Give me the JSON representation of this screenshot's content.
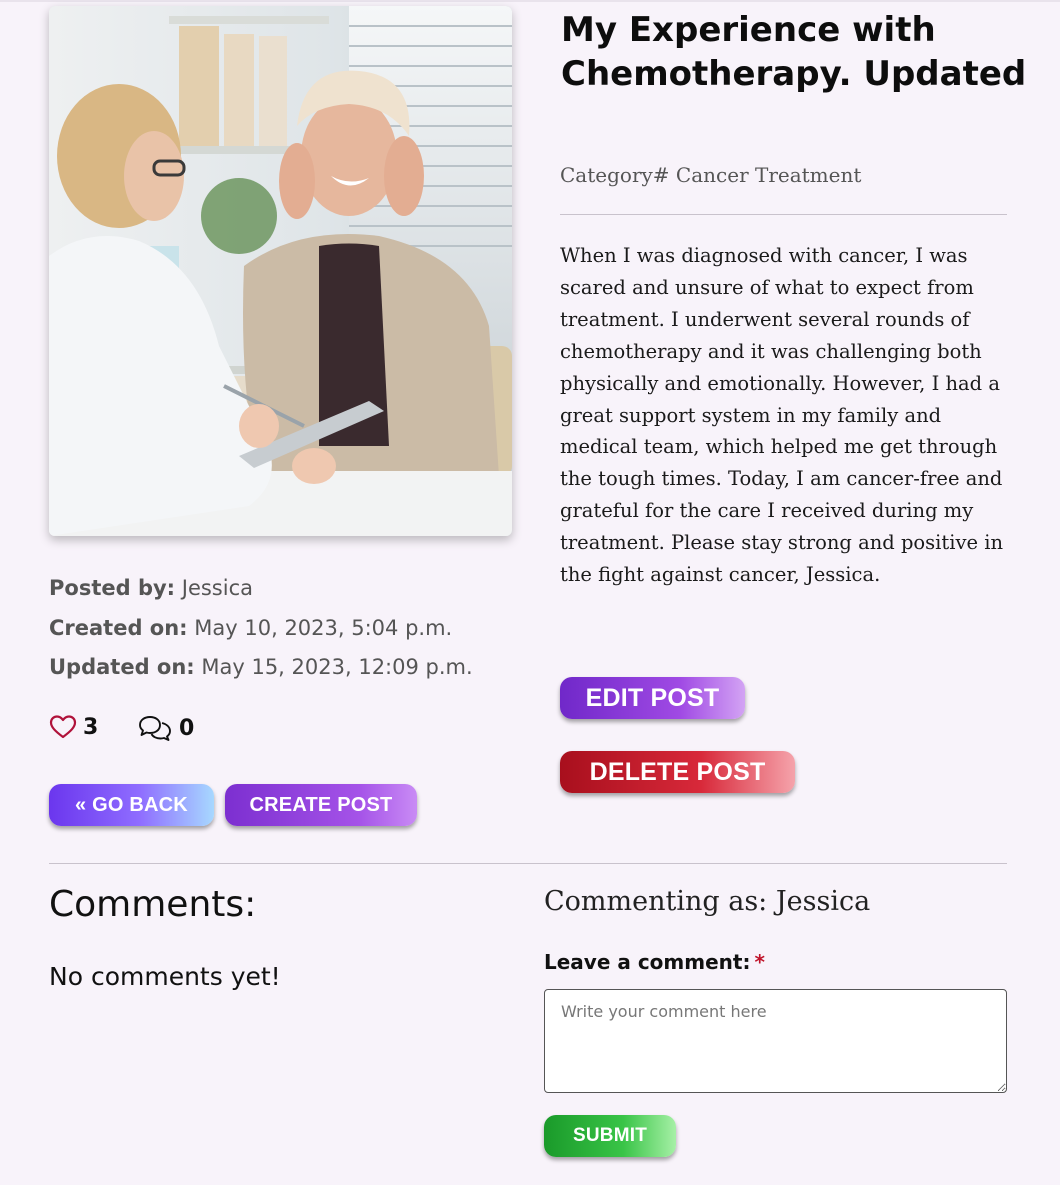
{
  "post": {
    "title": "My Experience with Chemotherapy. Updated",
    "category": "Category# Cancer Treatment",
    "body": "When I was diagnosed with cancer, I was scared and unsure of what to expect from treatment. I underwent several rounds of chemotherapy and it was challenging both physically and emotionally. However, I had a great support system in my family and medical team, which helped me get through the tough times. Today, I am cancer-free and grateful for the care I received during my treatment. Please stay strong and positive in the fight against cancer, Jessica.",
    "posted_by_label": "Posted by:",
    "posted_by": "Jessica",
    "created_label": "Created on:",
    "created_on": "May 10, 2023, 5:04 p.m.",
    "updated_label": "Updated on:",
    "updated_on": "May 15, 2023, 12:09 p.m.",
    "likes": "3",
    "comment_count": "0",
    "like_icon": "heart-outline-icon",
    "comment_icon": "chat-bubbles-icon"
  },
  "actions": {
    "go_back": "« GO BACK",
    "create_post": "CREATE POST",
    "edit_post": "EDIT POST",
    "delete_post": "DELETE POST"
  },
  "comments": {
    "heading": "Comments:",
    "empty_text": "No comments yet!",
    "commenting_as": "Commenting as: Jessica",
    "leave_label": "Leave a comment:",
    "required_mark": "*",
    "placeholder": "Write your comment here",
    "submit": "SUBMIT"
  },
  "colors": {
    "background": "#f8f3fa",
    "like_icon": "#b0123a",
    "edit": "#8a3ad8",
    "delete": "#c81e2e",
    "submit": "#26ad36",
    "go_back": "#6b36ee"
  }
}
